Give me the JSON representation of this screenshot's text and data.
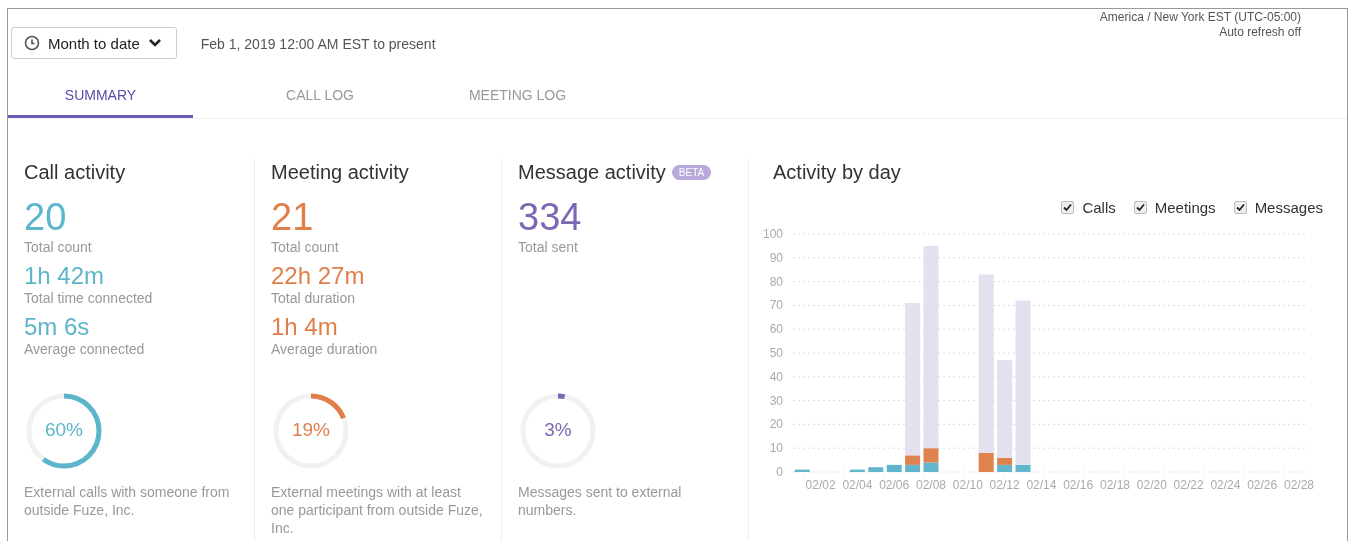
{
  "header": {
    "range_button": {
      "label": "Month to date"
    },
    "range_text": "Feb 1, 2019 12:00 AM EST to present",
    "timezone": "America / New York EST (UTC-05:00)",
    "refresh": "Auto refresh off"
  },
  "tabs": [
    {
      "label": "SUMMARY",
      "selected": true
    },
    {
      "label": "CALL LOG",
      "selected": false
    },
    {
      "label": "MEETING LOG",
      "selected": false
    }
  ],
  "panels": [
    {
      "title": "Call activity",
      "color": "#5db5cb",
      "stats": [
        {
          "value": "20",
          "label": "Total count",
          "kind": "big"
        },
        {
          "value": "1h 42m",
          "label": "Total time connected",
          "kind": "mid"
        },
        {
          "value": "5m 6s",
          "label": "Average connected",
          "kind": "mid"
        }
      ],
      "ring": {
        "level": 0.6,
        "reading": "60%"
      },
      "note": "External calls with someone from outside Fuze, Inc."
    },
    {
      "title": "Meeting activity",
      "color": "#e07f4a",
      "stats": [
        {
          "value": "21",
          "label": "Total count",
          "kind": "big"
        },
        {
          "value": "22h 27m",
          "label": "Total duration",
          "kind": "mid"
        },
        {
          "value": "1h 4m",
          "label": "Average duration",
          "kind": "mid"
        }
      ],
      "ring": {
        "level": 0.19,
        "reading": "19%"
      },
      "note": "External meetings with at least one participant from outside Fuze, Inc."
    },
    {
      "title": "Message activity",
      "badge": "BETA",
      "color": "#7d67b5",
      "stats": [
        {
          "value": "334",
          "label": "Total sent",
          "kind": "big"
        }
      ],
      "ring": {
        "level": 0.03,
        "reading": "3%"
      },
      "note": "Messages sent to external numbers."
    }
  ],
  "activity": {
    "title": "Activity by day",
    "legend": [
      {
        "checked": true
      },
      {
        "checked": true
      },
      {
        "checked": true
      }
    ],
    "chart_data": {
      "type": "bar",
      "stacked": true,
      "categories": [
        null,
        "02/02",
        null,
        "02/04",
        null,
        "02/06",
        null,
        "02/08",
        null,
        "02/10",
        null,
        "02/12",
        null,
        "02/14",
        null,
        "02/16",
        null,
        "02/18",
        null,
        "02/20",
        null,
        "02/22",
        null,
        "02/24",
        null,
        "02/26",
        null,
        "02/28"
      ],
      "series": [
        {
          "name": "Calls",
          "color": "#62b6cb",
          "values": [
            1,
            0,
            0,
            1,
            2,
            3,
            3,
            4,
            0,
            0,
            0,
            3,
            3,
            0,
            0,
            0,
            0,
            0,
            0,
            0,
            0,
            0,
            0,
            0,
            0,
            0,
            0,
            0
          ]
        },
        {
          "name": "Meetings",
          "color": "#de824e",
          "values": [
            0,
            0,
            0,
            0,
            0,
            0,
            4,
            6,
            0,
            0,
            8,
            3,
            0,
            0,
            0,
            0,
            0,
            0,
            0,
            0,
            0,
            0,
            0,
            0,
            0,
            0,
            0,
            0
          ]
        },
        {
          "name": "Messages",
          "color": "#e4e0ef",
          "values": [
            0,
            0,
            0,
            0,
            0,
            0,
            64,
            85,
            0,
            0,
            75,
            41,
            69,
            0,
            0,
            0,
            0,
            0,
            0,
            0,
            0,
            0,
            0,
            0,
            0,
            0,
            0,
            0
          ]
        }
      ],
      "grid": true,
      "ylim": [
        0,
        100
      ],
      "yticks": [
        0,
        10,
        20,
        30,
        40,
        50,
        60,
        70,
        80,
        90,
        100
      ]
    }
  }
}
